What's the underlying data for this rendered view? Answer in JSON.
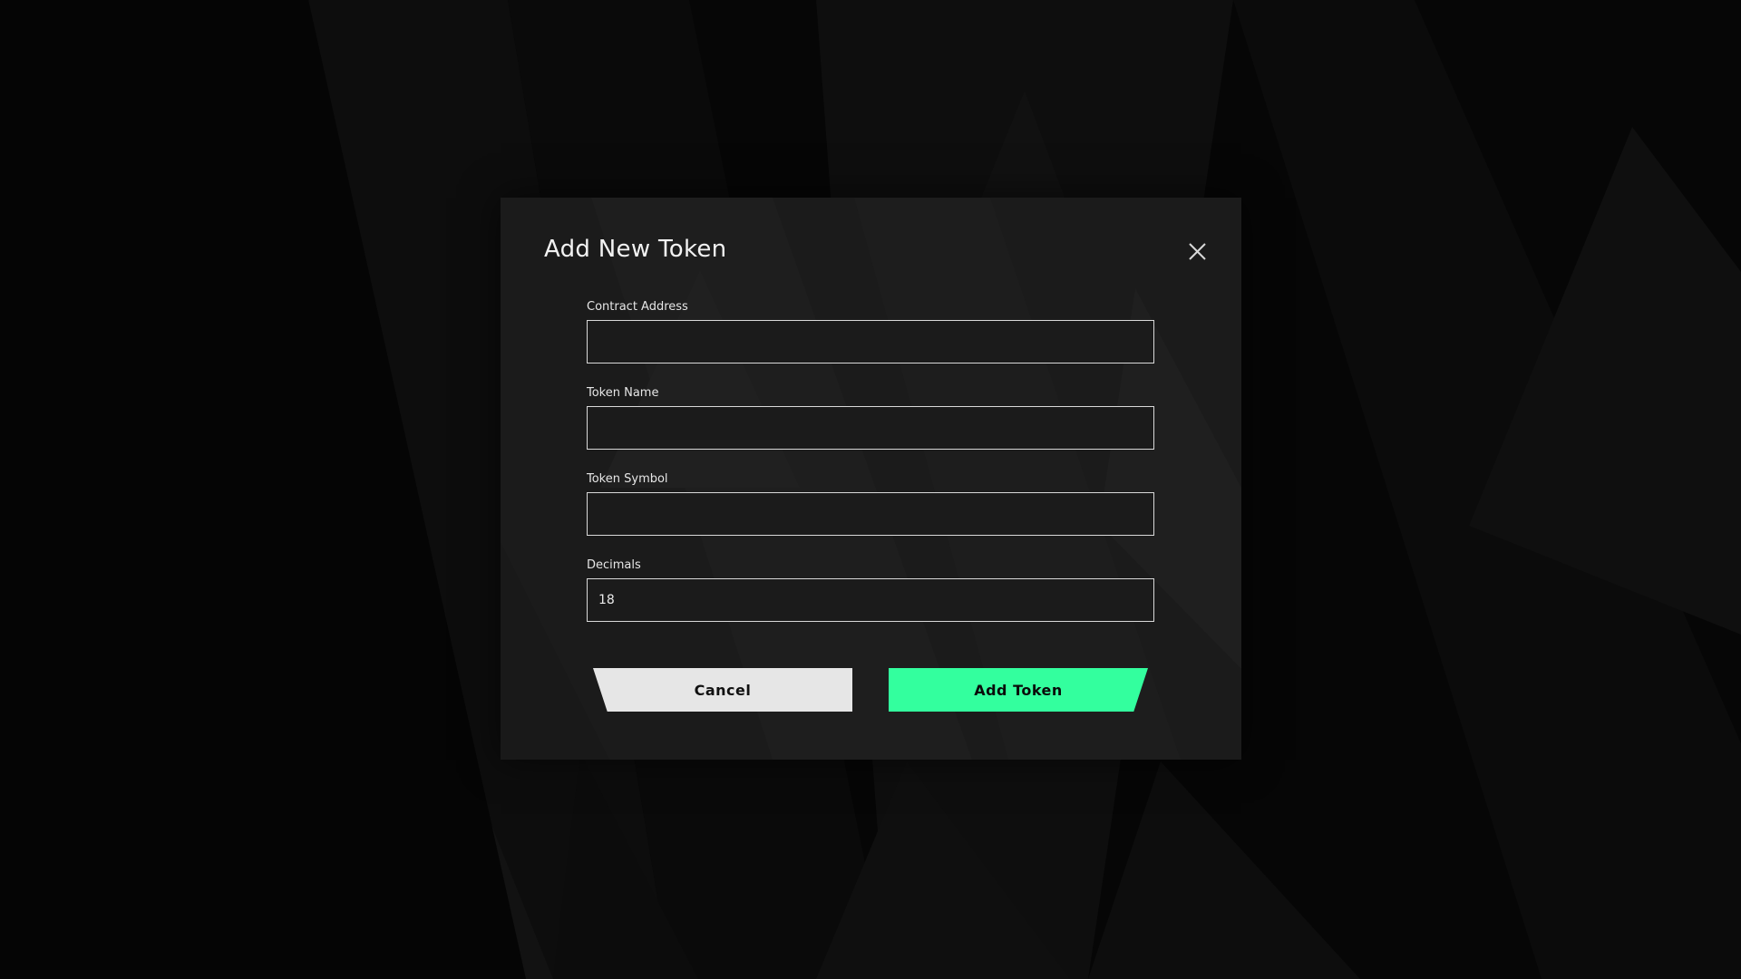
{
  "colors": {
    "page_background": "#060606",
    "modal_background": "#1b1b1b",
    "accent": "#33ff9e",
    "cancel_background": "#e6e6e6",
    "text": "#f2f2f2"
  },
  "modal": {
    "title": "Add New Token",
    "close_icon": "close-icon",
    "fields": [
      {
        "label": "Contract Address",
        "value": "",
        "placeholder": ""
      },
      {
        "label": "Token Name",
        "value": "",
        "placeholder": ""
      },
      {
        "label": "Token Symbol",
        "value": "",
        "placeholder": ""
      },
      {
        "label": "Decimals",
        "value": "18",
        "placeholder": ""
      }
    ],
    "cancel_label": "Cancel",
    "submit_label": "Add Token"
  }
}
